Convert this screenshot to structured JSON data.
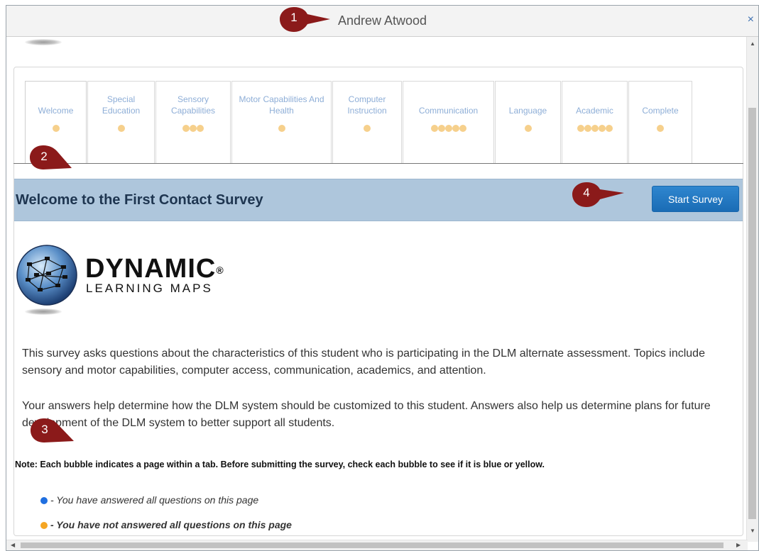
{
  "window": {
    "title": "Andrew Atwood",
    "close_label": "×"
  },
  "tabs": [
    {
      "label": "Welcome",
      "dots": 1
    },
    {
      "label": "Special Education",
      "dots": 1
    },
    {
      "label": "Sensory Capabilities",
      "dots": 3
    },
    {
      "label": "Motor Capabilities And Health",
      "dots": 1
    },
    {
      "label": "Computer Instruction",
      "dots": 1
    },
    {
      "label": "Communication",
      "dots": 5
    },
    {
      "label": "Language",
      "dots": 1
    },
    {
      "label": "Academic",
      "dots": 5
    },
    {
      "label": "Complete",
      "dots": 1
    }
  ],
  "banner": {
    "title": "Welcome to the First Contact Survey",
    "start_button": "Start Survey"
  },
  "logo": {
    "word": "DYNAMIC",
    "registered": "®",
    "sub": "LEARNING MAPS"
  },
  "content": {
    "para1": "This survey asks questions about the characteristics of this student who is participating in the DLM alternate assessment. Topics include sensory and motor capabilities, computer access, communication, academics, and attention.",
    "para2": "Your answers help determine how the DLM system should be customized to this student. Answers also help us determine plans for future development of the DLM system to better support all students.",
    "note": "Note: Each bubble indicates a page within a tab. Before submitting the survey, check each bubble to see if it is blue or yellow.",
    "legend_answered": "- You have answered all questions on this page",
    "legend_not_answered": "- You have not answered all questions on this page"
  },
  "markers": [
    "1",
    "2",
    "3",
    "4"
  ],
  "colors": {
    "blue_dot": "#1f6fe0",
    "orange_dot": "#f5a623",
    "tab_dot": "#f6d08c",
    "banner": "#aec6dc",
    "marker": "#8b1a1a"
  }
}
